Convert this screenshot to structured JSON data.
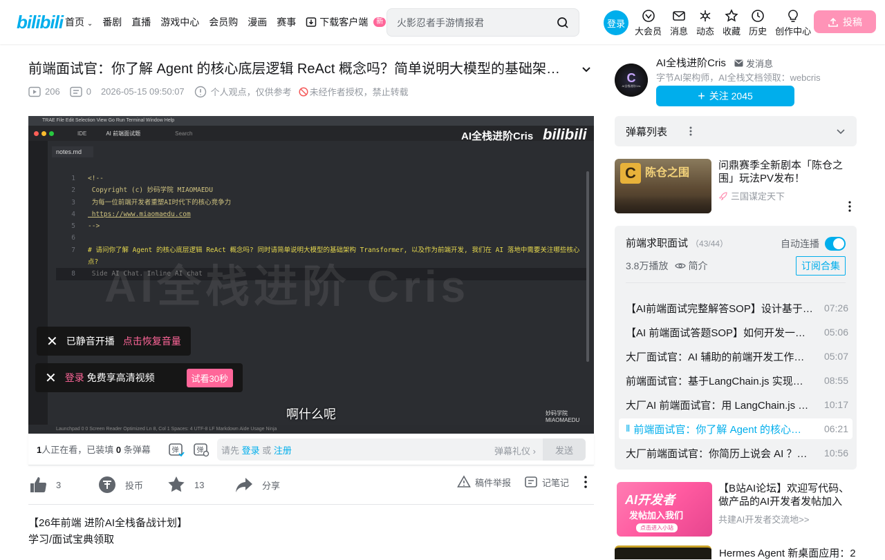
{
  "header": {
    "logo": "bilibili",
    "nav": [
      "首页",
      "番剧",
      "直播",
      "游戏中心",
      "会员购",
      "漫画",
      "赛事",
      "下载客户端"
    ],
    "new_badge": "新",
    "search_placeholder": "火影忍者手游情报君",
    "login": "登录",
    "right_icons": [
      {
        "label": "大会员",
        "icon": "vip-icon"
      },
      {
        "label": "消息",
        "icon": "message-icon"
      },
      {
        "label": "动态",
        "icon": "dynamic-icon"
      },
      {
        "label": "收藏",
        "icon": "favorite-icon"
      },
      {
        "label": "历史",
        "icon": "history-icon"
      },
      {
        "label": "创作中心",
        "icon": "creator-icon"
      }
    ],
    "upload": "投稿"
  },
  "video": {
    "title": "前端面试官：你了解 Agent 的核心底层逻辑 ReAct 概念吗？简单说明大模型的基础架构 Transformer，以及作为前端开发，我们在 AI 落地中需要关注哪些核心点？",
    "plays": "206",
    "danmaku_count": "0",
    "pubdate": "2026-05-15 09:50:07",
    "notice": "个人观点，仅供参考",
    "forbid": "未经作者授权，禁止转载"
  },
  "player": {
    "ide_menu": "TRAE  File  Edit  Selection  View  Go  Run  Terminal  Window  Help",
    "ide_tab": "IDE",
    "ide_tab2": "AI 前端面试题",
    "ide_search": "Search",
    "file_tab": "notes.md",
    "watermark_top": "AI全栈进阶Cris",
    "bili_mark": "bilibili",
    "code_lines": [
      {
        "n": "1",
        "t": "<!--"
      },
      {
        "n": "2",
        "t": "  Copyright (c) 妙码学院 MIAOMAEDU"
      },
      {
        "n": "3",
        "t": "  为每一位前端开发者重塑AI时代下的核心竞争力"
      },
      {
        "n": "4",
        "t": "  https://www.miaomaedu.com"
      },
      {
        "n": "5",
        "t": "-->"
      },
      {
        "n": "6",
        "t": ""
      },
      {
        "n": "7",
        "t": "# 请问你了解 Agent 的核心底层逻辑 ReAct 概念吗? 同时请简单说明大模型的基础架构 Transformer, 以及作为前端开发, 我们在 AI 落地中需要关注哪些核心"
      },
      {
        "n": "",
        "t": "点?"
      },
      {
        "n": "8",
        "t": "  Side AI Chat.  Inline AI chat"
      }
    ],
    "big_watermark": "AI全栈进阶 Cris",
    "subtitle": "啊什么呢",
    "miaoma": "妙码学院 MIAOMAEDU",
    "statusbar": "Launchpad  0  0    Screen Reader Optimized  Ln 8, Col 1  Spaces: 4  UTF-8  LF  Markdown  Aide Usage  Ninja",
    "toast_mute": "已静音开播",
    "toast_mute_action": "点击恢复音量",
    "toast_login": "登录",
    "toast_hd": "免费享高清视频",
    "toast_trial": "试看30秒"
  },
  "bottom_bar": {
    "watching_num": "1",
    "watching_text": "人正在看，已装填",
    "dm_num": "0",
    "dm_text": "条弹幕",
    "input_prefix": "请先",
    "input_login": "登录",
    "input_or": "或",
    "input_register": "注册",
    "etiquette": "弹幕礼仪",
    "send": "发送"
  },
  "actions": {
    "like": "3",
    "coin": "投币",
    "favorite": "13",
    "share": "分享",
    "report": "稿件举报",
    "notes": "记笔记"
  },
  "description": [
    "【26年前端 进阶AI全栈备战计划】",
    "学习/面试宝典领取"
  ],
  "uploader": {
    "avatar_text": "AI全栈进阶Cris",
    "name": "AI全栈进阶Cris",
    "message": "发消息",
    "desc": "字节AI架构师，AI全栈文档领取：webcris",
    "follow": "关注 2045"
  },
  "danmaku_list": "弹幕列表",
  "ad1": {
    "title": "问鼎赛季全新剧本「陈仓之围」玩法PV发布！",
    "sub": "三国谋定天下",
    "img_text": "陈仓之围"
  },
  "collection": {
    "title": "前端求职面试",
    "count": "（43/44）",
    "autoplay": "自动连播",
    "plays": "3.8万播放",
    "intro": "简介",
    "subscribe": "订阅合集",
    "episodes": [
      {
        "t": "【AI前端面试完整解答SOP】设计基于…",
        "d": "07:26"
      },
      {
        "t": "【AI 前端面试答题SOP】如何开发一…",
        "d": "05:06"
      },
      {
        "t": "大厂面试官：AI 辅助的前端开发工作…",
        "d": "05:07"
      },
      {
        "t": "前端面试官：基于LangChain.js 实现一…",
        "d": "08:55"
      },
      {
        "t": "大厂AI 前端面试官：用 LangChain.js …",
        "d": "10:17"
      },
      {
        "t": "前端面试官：你了解 Agent 的核心…",
        "d": "06:21"
      },
      {
        "t": "大厂前端面试官：你简历上说会 AI ？…",
        "d": "10:56"
      }
    ]
  },
  "ad2": {
    "title": "【B站AI论坛】欢迎写代码、做产品的AI开发者发帖加入",
    "sub": "共建AI开发者交流地>>",
    "img_line1": "AI开发者",
    "img_line2": "发帖加入我们",
    "img_line3": "点击进入小站"
  },
  "ad3": {
    "title": "Hermes Agent 新桌面应用：2"
  },
  "colors": {
    "accent": "#00aeec",
    "pink": "#ff6699"
  }
}
